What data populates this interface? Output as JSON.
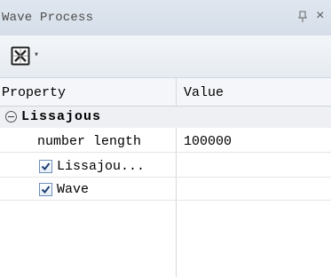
{
  "window": {
    "title": "Wave Process",
    "pin_glyph": "ᴪ",
    "close_glyph": "×"
  },
  "toolbar": {
    "button_icon": "boxed-x-icon",
    "dropdown_glyph": "▾"
  },
  "grid": {
    "headers": {
      "property": "Property",
      "value": "Value"
    },
    "category": {
      "label": "Lissajous",
      "expanded": true
    },
    "rows": [
      {
        "label": "number length",
        "value": "100000",
        "type": "text"
      },
      {
        "label": "Lissajou...",
        "value": "",
        "type": "checkbox",
        "checked": true
      },
      {
        "label": "Wave",
        "value": "",
        "type": "checkbox",
        "checked": true
      }
    ]
  },
  "colors": {
    "title_bar": "#dfe6ef",
    "toolbar": "#eef2f6",
    "header": "#f4f6f9",
    "category_row": "#eef0f4",
    "checkbox_border": "#6d8fb8",
    "check_mark": "#1f3f75"
  }
}
